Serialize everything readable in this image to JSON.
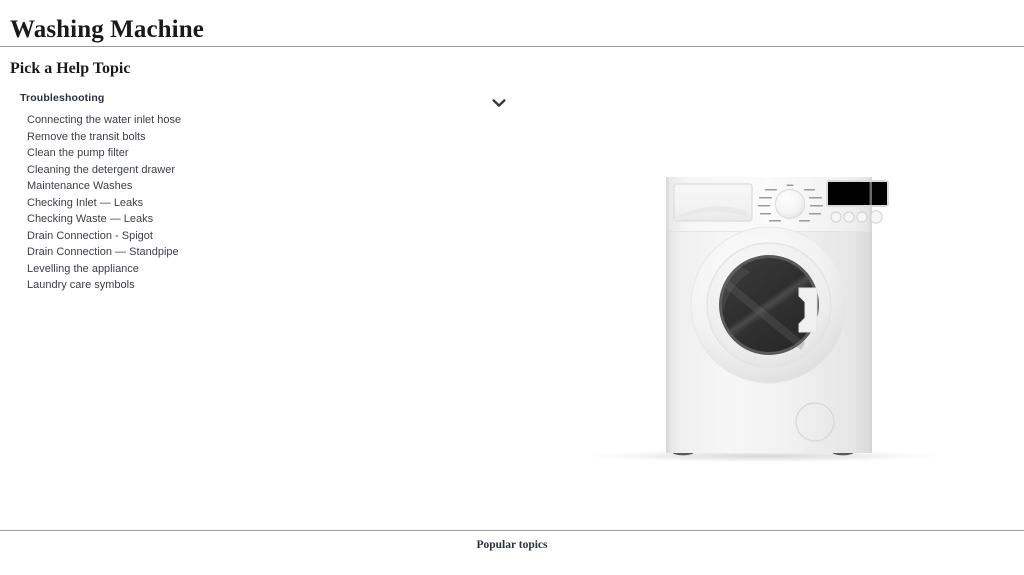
{
  "header": {
    "title": "Washing Machine"
  },
  "section": {
    "title": "Pick a Help Topic"
  },
  "topics": {
    "group_label": "Troubleshooting",
    "items": [
      "Connecting the water inlet hose",
      "Remove the transit bolts",
      "Clean the pump filter",
      "Cleaning the detergent drawer",
      "Maintenance Washes",
      "Checking Inlet — Leaks",
      "Checking Waste — Leaks",
      "Drain Connection - Spigot",
      "Drain Connection — Standpipe",
      "Levelling the appliance",
      "Laundry care symbols"
    ]
  },
  "expand_control": {
    "icon": "chevron-down-icon"
  },
  "illustration": {
    "name": "washing-machine-illustration",
    "alt": "Front-loading washing machine",
    "parts": [
      "detergent-drawer",
      "program-dial",
      "display-panel",
      "control-buttons",
      "door",
      "pump-filter-cover",
      "feet"
    ]
  },
  "footer": {
    "heading": "Popular topics"
  },
  "colors": {
    "page_background": "#ffffff",
    "divider": "#9b9b9b",
    "heading_text": "#1a1a1a",
    "group_label_text": "#2b2f42",
    "topic_text": "#3c4048",
    "chevron": "#3a3a3a",
    "machine_body": "#f2f2f2",
    "machine_door_glass": "#323232",
    "display_panel": "#000000"
  }
}
